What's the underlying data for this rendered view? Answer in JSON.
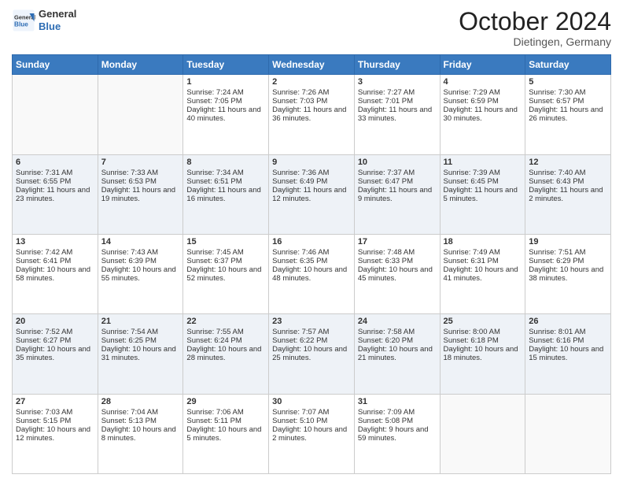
{
  "header": {
    "logo_line1": "General",
    "logo_line2": "Blue",
    "month": "October 2024",
    "location": "Dietingen, Germany"
  },
  "days_of_week": [
    "Sunday",
    "Monday",
    "Tuesday",
    "Wednesday",
    "Thursday",
    "Friday",
    "Saturday"
  ],
  "weeks": [
    [
      {
        "day": "",
        "sunrise": "",
        "sunset": "",
        "daylight": ""
      },
      {
        "day": "",
        "sunrise": "",
        "sunset": "",
        "daylight": ""
      },
      {
        "day": "1",
        "sunrise": "Sunrise: 7:24 AM",
        "sunset": "Sunset: 7:05 PM",
        "daylight": "Daylight: 11 hours and 40 minutes."
      },
      {
        "day": "2",
        "sunrise": "Sunrise: 7:26 AM",
        "sunset": "Sunset: 7:03 PM",
        "daylight": "Daylight: 11 hours and 36 minutes."
      },
      {
        "day": "3",
        "sunrise": "Sunrise: 7:27 AM",
        "sunset": "Sunset: 7:01 PM",
        "daylight": "Daylight: 11 hours and 33 minutes."
      },
      {
        "day": "4",
        "sunrise": "Sunrise: 7:29 AM",
        "sunset": "Sunset: 6:59 PM",
        "daylight": "Daylight: 11 hours and 30 minutes."
      },
      {
        "day": "5",
        "sunrise": "Sunrise: 7:30 AM",
        "sunset": "Sunset: 6:57 PM",
        "daylight": "Daylight: 11 hours and 26 minutes."
      }
    ],
    [
      {
        "day": "6",
        "sunrise": "Sunrise: 7:31 AM",
        "sunset": "Sunset: 6:55 PM",
        "daylight": "Daylight: 11 hours and 23 minutes."
      },
      {
        "day": "7",
        "sunrise": "Sunrise: 7:33 AM",
        "sunset": "Sunset: 6:53 PM",
        "daylight": "Daylight: 11 hours and 19 minutes."
      },
      {
        "day": "8",
        "sunrise": "Sunrise: 7:34 AM",
        "sunset": "Sunset: 6:51 PM",
        "daylight": "Daylight: 11 hours and 16 minutes."
      },
      {
        "day": "9",
        "sunrise": "Sunrise: 7:36 AM",
        "sunset": "Sunset: 6:49 PM",
        "daylight": "Daylight: 11 hours and 12 minutes."
      },
      {
        "day": "10",
        "sunrise": "Sunrise: 7:37 AM",
        "sunset": "Sunset: 6:47 PM",
        "daylight": "Daylight: 11 hours and 9 minutes."
      },
      {
        "day": "11",
        "sunrise": "Sunrise: 7:39 AM",
        "sunset": "Sunset: 6:45 PM",
        "daylight": "Daylight: 11 hours and 5 minutes."
      },
      {
        "day": "12",
        "sunrise": "Sunrise: 7:40 AM",
        "sunset": "Sunset: 6:43 PM",
        "daylight": "Daylight: 11 hours and 2 minutes."
      }
    ],
    [
      {
        "day": "13",
        "sunrise": "Sunrise: 7:42 AM",
        "sunset": "Sunset: 6:41 PM",
        "daylight": "Daylight: 10 hours and 58 minutes."
      },
      {
        "day": "14",
        "sunrise": "Sunrise: 7:43 AM",
        "sunset": "Sunset: 6:39 PM",
        "daylight": "Daylight: 10 hours and 55 minutes."
      },
      {
        "day": "15",
        "sunrise": "Sunrise: 7:45 AM",
        "sunset": "Sunset: 6:37 PM",
        "daylight": "Daylight: 10 hours and 52 minutes."
      },
      {
        "day": "16",
        "sunrise": "Sunrise: 7:46 AM",
        "sunset": "Sunset: 6:35 PM",
        "daylight": "Daylight: 10 hours and 48 minutes."
      },
      {
        "day": "17",
        "sunrise": "Sunrise: 7:48 AM",
        "sunset": "Sunset: 6:33 PM",
        "daylight": "Daylight: 10 hours and 45 minutes."
      },
      {
        "day": "18",
        "sunrise": "Sunrise: 7:49 AM",
        "sunset": "Sunset: 6:31 PM",
        "daylight": "Daylight: 10 hours and 41 minutes."
      },
      {
        "day": "19",
        "sunrise": "Sunrise: 7:51 AM",
        "sunset": "Sunset: 6:29 PM",
        "daylight": "Daylight: 10 hours and 38 minutes."
      }
    ],
    [
      {
        "day": "20",
        "sunrise": "Sunrise: 7:52 AM",
        "sunset": "Sunset: 6:27 PM",
        "daylight": "Daylight: 10 hours and 35 minutes."
      },
      {
        "day": "21",
        "sunrise": "Sunrise: 7:54 AM",
        "sunset": "Sunset: 6:25 PM",
        "daylight": "Daylight: 10 hours and 31 minutes."
      },
      {
        "day": "22",
        "sunrise": "Sunrise: 7:55 AM",
        "sunset": "Sunset: 6:24 PM",
        "daylight": "Daylight: 10 hours and 28 minutes."
      },
      {
        "day": "23",
        "sunrise": "Sunrise: 7:57 AM",
        "sunset": "Sunset: 6:22 PM",
        "daylight": "Daylight: 10 hours and 25 minutes."
      },
      {
        "day": "24",
        "sunrise": "Sunrise: 7:58 AM",
        "sunset": "Sunset: 6:20 PM",
        "daylight": "Daylight: 10 hours and 21 minutes."
      },
      {
        "day": "25",
        "sunrise": "Sunrise: 8:00 AM",
        "sunset": "Sunset: 6:18 PM",
        "daylight": "Daylight: 10 hours and 18 minutes."
      },
      {
        "day": "26",
        "sunrise": "Sunrise: 8:01 AM",
        "sunset": "Sunset: 6:16 PM",
        "daylight": "Daylight: 10 hours and 15 minutes."
      }
    ],
    [
      {
        "day": "27",
        "sunrise": "Sunrise: 7:03 AM",
        "sunset": "Sunset: 5:15 PM",
        "daylight": "Daylight: 10 hours and 12 minutes."
      },
      {
        "day": "28",
        "sunrise": "Sunrise: 7:04 AM",
        "sunset": "Sunset: 5:13 PM",
        "daylight": "Daylight: 10 hours and 8 minutes."
      },
      {
        "day": "29",
        "sunrise": "Sunrise: 7:06 AM",
        "sunset": "Sunset: 5:11 PM",
        "daylight": "Daylight: 10 hours and 5 minutes."
      },
      {
        "day": "30",
        "sunrise": "Sunrise: 7:07 AM",
        "sunset": "Sunset: 5:10 PM",
        "daylight": "Daylight: 10 hours and 2 minutes."
      },
      {
        "day": "31",
        "sunrise": "Sunrise: 7:09 AM",
        "sunset": "Sunset: 5:08 PM",
        "daylight": "Daylight: 9 hours and 59 minutes."
      },
      {
        "day": "",
        "sunrise": "",
        "sunset": "",
        "daylight": ""
      },
      {
        "day": "",
        "sunrise": "",
        "sunset": "",
        "daylight": ""
      }
    ]
  ]
}
